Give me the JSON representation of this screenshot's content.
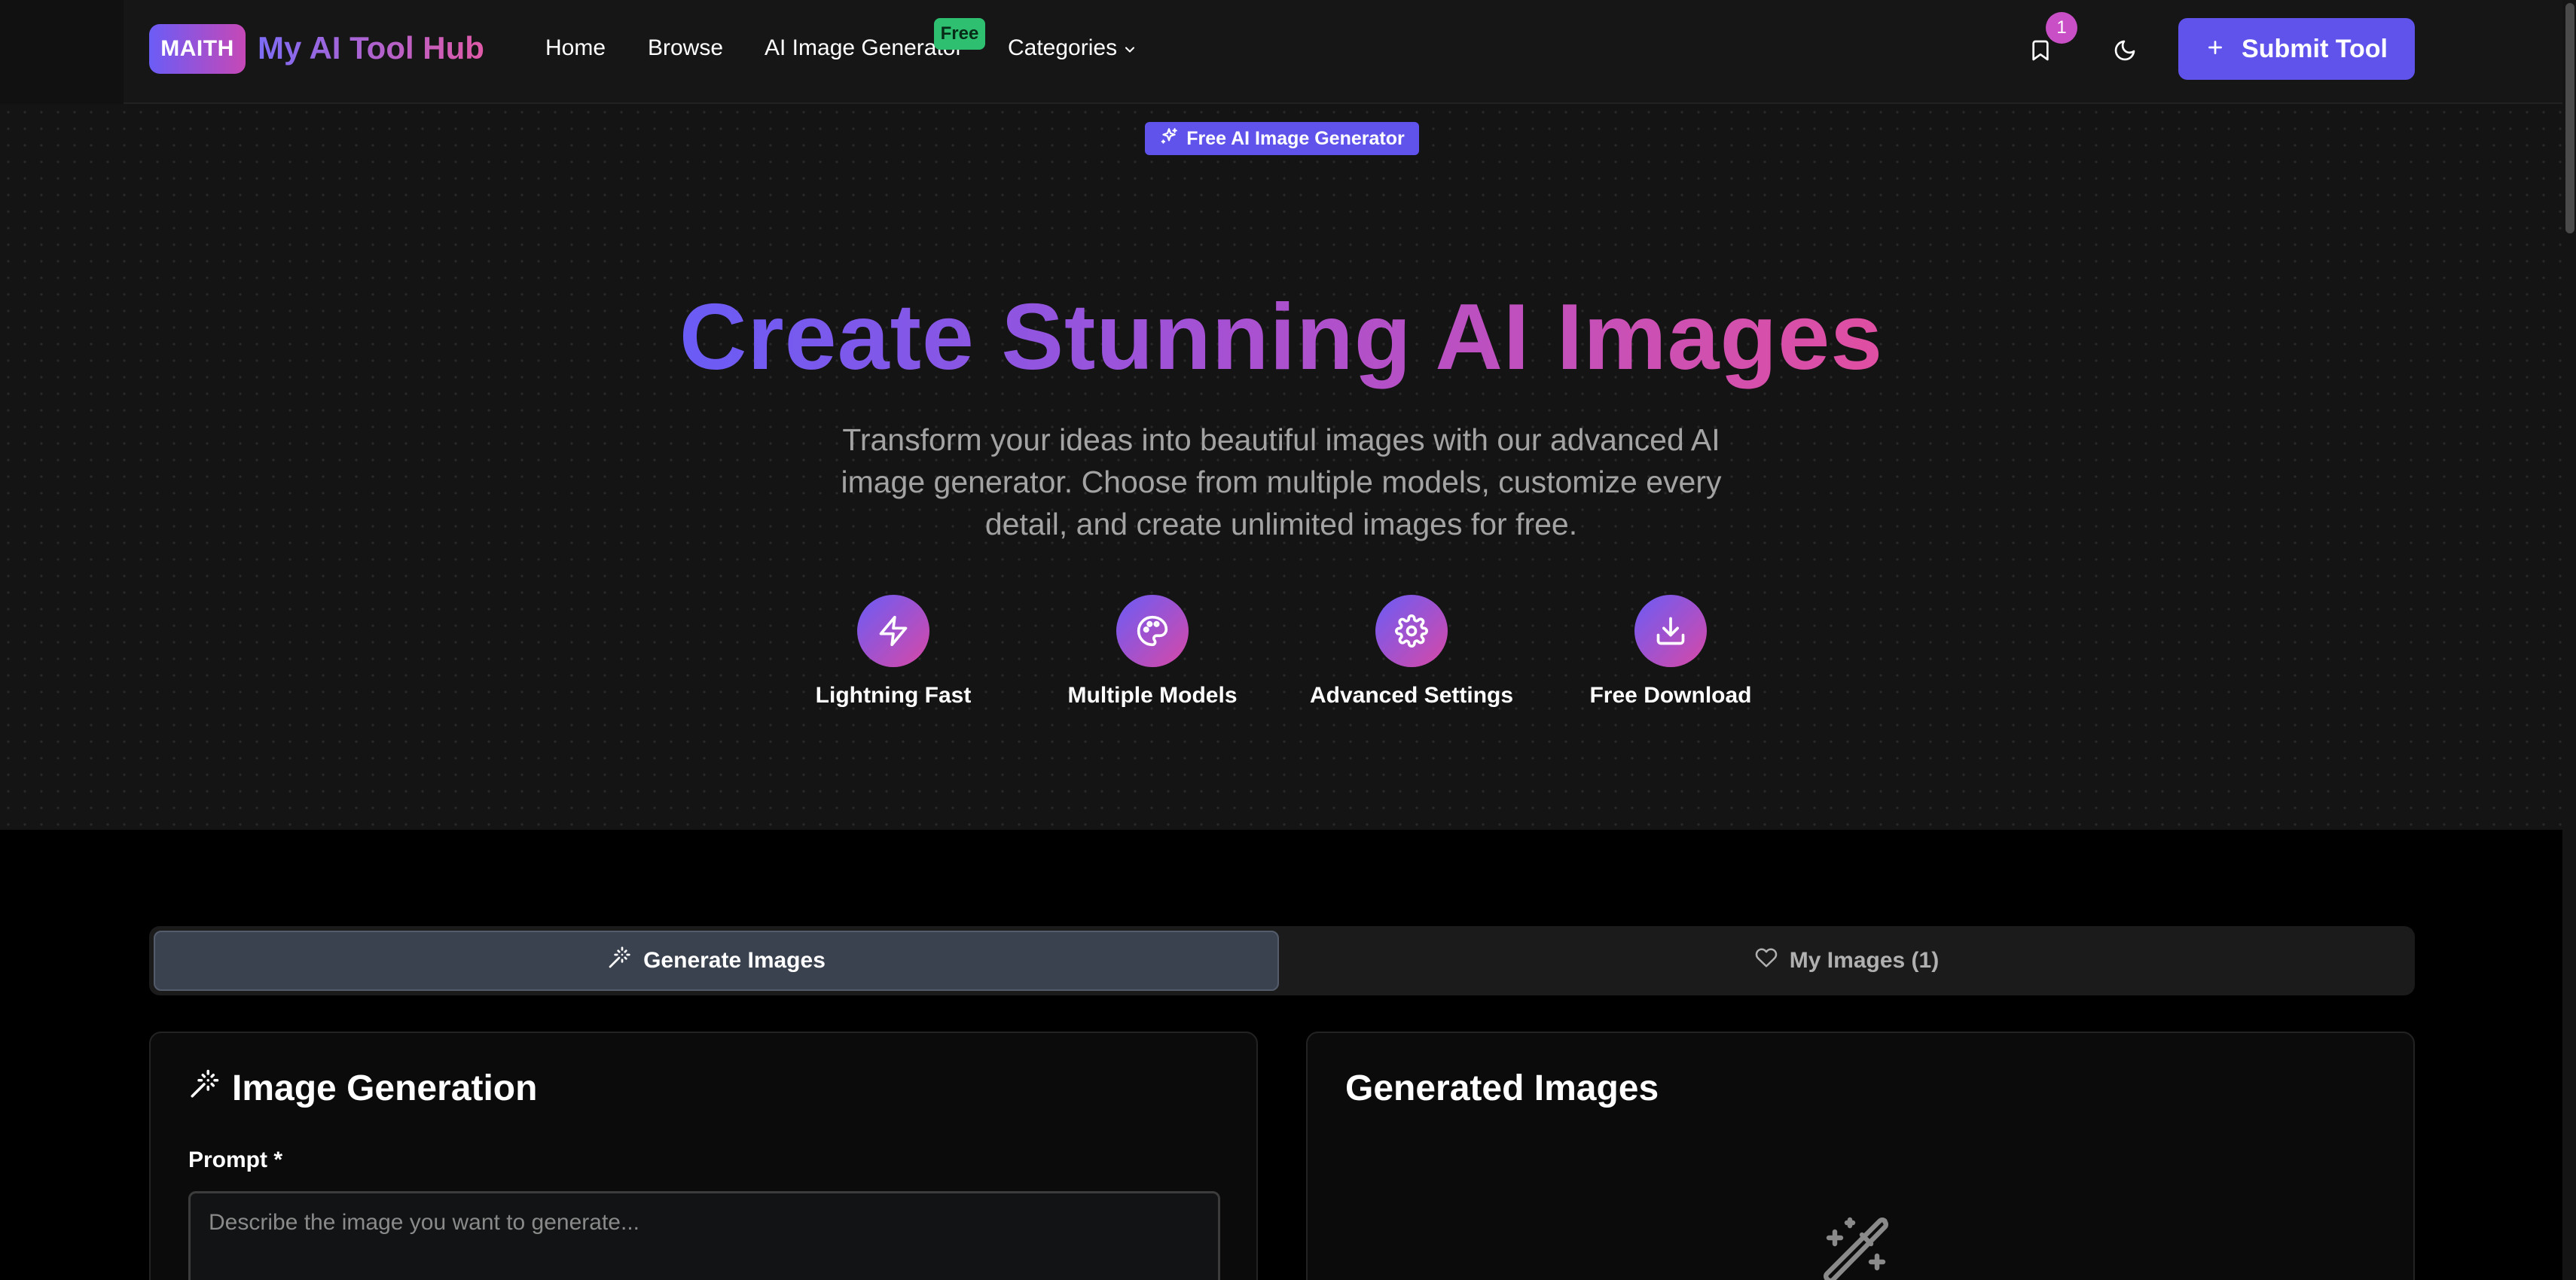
{
  "navbar": {
    "logo_badge": "MAITH",
    "logo_text": "My AI Tool Hub",
    "links": {
      "home": "Home",
      "browse": "Browse",
      "ai_image_generator": "AI Image Generator",
      "categories": "Categories"
    },
    "free_badge": "Free",
    "bookmark_count": "1",
    "submit_button": "Submit Tool"
  },
  "hero": {
    "badge": "Free AI Image Generator",
    "title": "Create Stunning AI Images",
    "subtitle": "Transform your ideas into beautiful images with our advanced AI image generator. Choose from multiple models, customize every detail, and create unlimited images for free.",
    "features": [
      {
        "label": "Lightning Fast",
        "icon": "lightning-icon"
      },
      {
        "label": "Multiple Models",
        "icon": "palette-icon"
      },
      {
        "label": "Advanced Settings",
        "icon": "gear-icon"
      },
      {
        "label": "Free Download",
        "icon": "download-icon"
      }
    ]
  },
  "tabs": {
    "generate": "Generate Images",
    "my_images": "My Images (1)"
  },
  "generation": {
    "title": "Image Generation",
    "prompt_label": "Prompt *",
    "prompt_placeholder": "Describe the image you want to generate..."
  },
  "results": {
    "title": "Generated Images"
  },
  "colors": {
    "accent": "#5f53ec",
    "gradient_start": "#6a5cf6",
    "gradient_end": "#e04fa2",
    "free_badge": "#2fbf71",
    "notification": "#c94fc6"
  }
}
